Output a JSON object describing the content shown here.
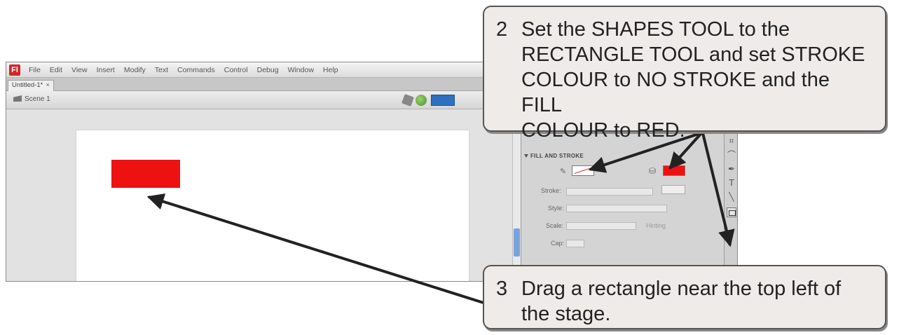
{
  "app": {
    "logo": "Fl",
    "menu": [
      "File",
      "Edit",
      "View",
      "Insert",
      "Modify",
      "Text",
      "Commands",
      "Control",
      "Debug",
      "Window",
      "Help"
    ],
    "doc_tab": "Untitled-1*",
    "doc_tab_close": "×",
    "scene_label": "Scene 1",
    "properties": {
      "section_title": "FILL AND STROKE",
      "stroke_label": "Stroke:",
      "style_label": "Style:",
      "scale_label": "Scale:",
      "cap_label": "Cap:",
      "scale_hinting": "Hinting",
      "stroke_color": "#ffffff",
      "fill_color": "#ee1111"
    },
    "shape_color": "#ee1111"
  },
  "callouts": [
    {
      "number": "2",
      "text": "Set the SHAPES TOOL to the\nRECTANGLE TOOL and set STROKE\nCOLOUR to NO STROKE and the FILL\nCOLOUR to RED."
    },
    {
      "number": "3",
      "text": "Drag a rectangle near the top left of\nthe stage."
    }
  ]
}
